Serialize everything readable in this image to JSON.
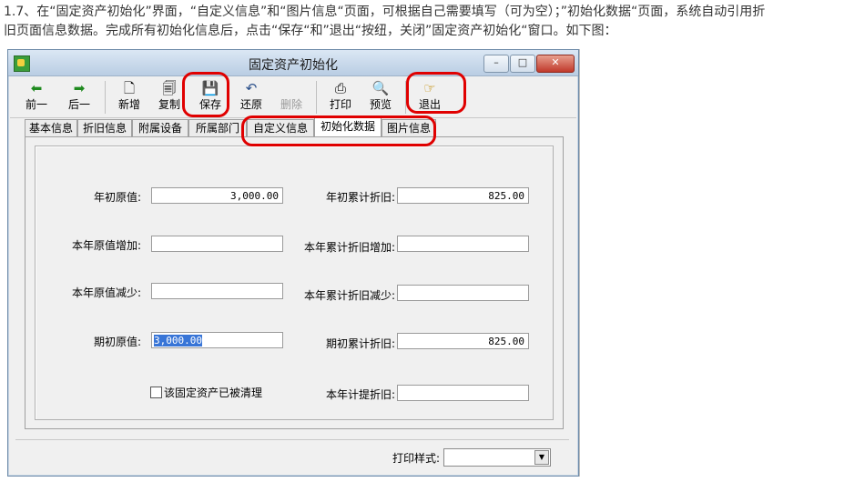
{
  "doc": {
    "line1": "1.7、在“固定资产初始化”界面，“自定义信息”和“图片信息“页面，可根据自己需要填写（可为空）；”初始化数据“页面，系统自动引用折",
    "line2": "旧页面信息数据。完成所有初始化信息后，点击“保存“和”退出“按纽，关闭”固定资产初始化“窗口。如下图："
  },
  "window": {
    "title": "固定资产初始化",
    "min": "–",
    "max": "□",
    "close": "✕"
  },
  "toolbar": {
    "prev": "前一",
    "next": "后一",
    "new": "新增",
    "copy": "复制",
    "save": "保存",
    "undo": "还原",
    "delete": "删除",
    "print": "打印",
    "preview": "预览",
    "exit": "退出"
  },
  "icons": {
    "prev": "prev-arrow-icon",
    "next": "next-arrow-icon",
    "new": "new-doc-icon",
    "copy": "copy-icon",
    "save": "floppy-icon",
    "undo": "undo-icon",
    "delete": "delete-icon",
    "print": "printer-icon",
    "preview": "preview-icon",
    "exit": "exit-hand-icon"
  },
  "tabs": [
    "基本信息",
    "折旧信息",
    "附属设备",
    "所属部门",
    "自定义信息",
    "初始化数据",
    "图片信息"
  ],
  "active_tab": "初始化数据",
  "form": {
    "opening_value_label": "年初原值:",
    "opening_value": "3,000.00",
    "opening_accum_dep_label": "年初累计折旧:",
    "opening_accum_dep": "825.00",
    "year_value_increase_label": "本年原值增加:",
    "year_value_increase": "",
    "year_accum_dep_increase_label": "本年累计折旧增加:",
    "year_accum_dep_increase": "",
    "year_value_decrease_label": "本年原值减少:",
    "year_value_decrease": "",
    "year_accum_dep_decrease_label": "本年累计折旧减少:",
    "year_accum_dep_decrease": "",
    "period_value_label": "期初原值:",
    "period_value": "3,000.00",
    "period_accum_dep_label": "期初累计折旧:",
    "period_accum_dep": "825.00",
    "cleared_label": "该固定资产已被清理",
    "year_dep_label": "本年计提折旧:",
    "year_dep": ""
  },
  "footer": {
    "print_style_label": "打印样式:",
    "print_style_value": ""
  },
  "colors": {
    "highlight": "#e00000",
    "selection": "#3875d7"
  }
}
